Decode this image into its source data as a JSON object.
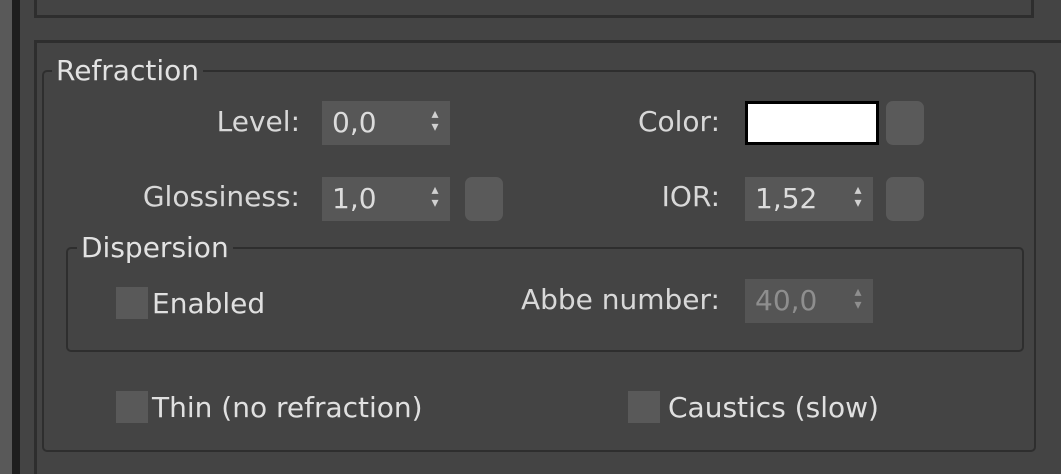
{
  "refraction": {
    "title": "Refraction",
    "level": {
      "label": "Level:",
      "value": "0,0",
      "arrows": "▴\n▾"
    },
    "color": {
      "label": "Color:",
      "swatch_color": "#ffffff"
    },
    "glossiness": {
      "label": "Glossiness:",
      "value": "1,0",
      "arrows": "▴\n▾"
    },
    "ior": {
      "label": "IOR:",
      "value": "1,52",
      "arrows": "▴\n▾"
    },
    "dispersion": {
      "title": "Dispersion",
      "enabled": {
        "label": "Enabled",
        "checked": false
      },
      "abbe": {
        "label": "Abbe number:",
        "value": "40,0",
        "disabled": true,
        "arrows": "▴\n▾"
      }
    },
    "thin": {
      "label": "Thin (no refraction)",
      "checked": false
    },
    "caustics": {
      "label": "Caustics (slow)",
      "checked": false
    }
  }
}
